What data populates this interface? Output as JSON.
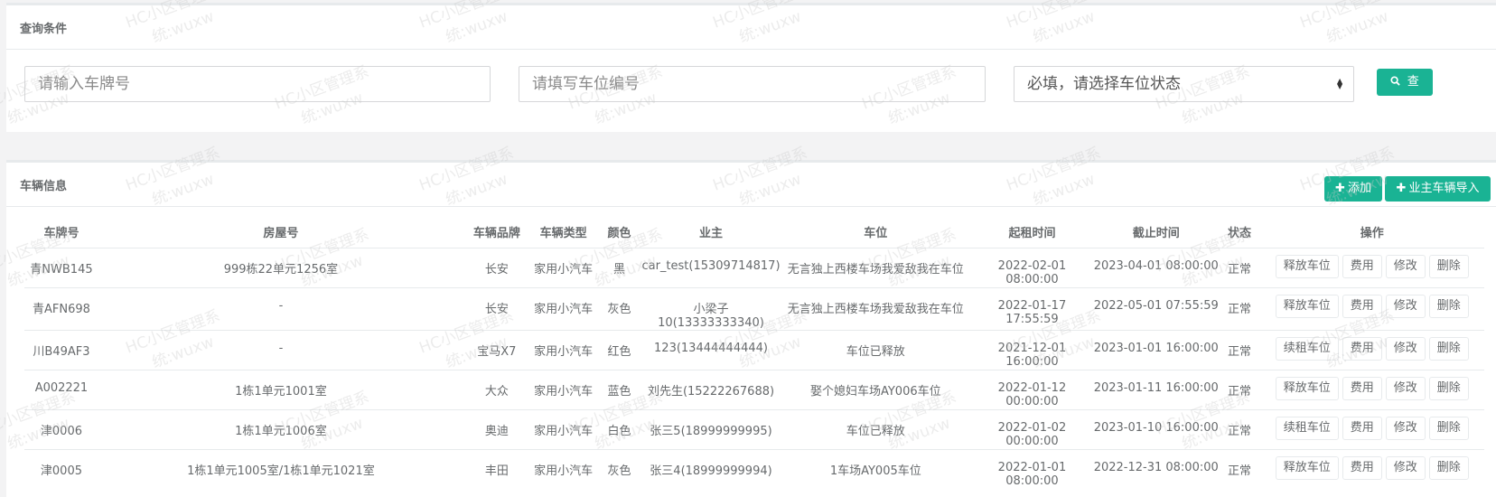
{
  "query": {
    "title": "查询条件",
    "plate_placeholder": "请输入车牌号",
    "space_placeholder": "请填写车位编号",
    "status_value": "必填，请选择车位状态",
    "search_label": "查询"
  },
  "vehicles": {
    "title": "车辆信息",
    "add_label": "添加",
    "import_label": "业主车辆导入",
    "columns": [
      "车牌号",
      "房屋号",
      "车辆品牌",
      "车辆类型",
      "颜色",
      "业主",
      "车位",
      "起租时间",
      "截止时间",
      "状态",
      "操作"
    ],
    "rows": [
      [
        "青NWB145",
        "999栋22单元1256室",
        "长安",
        "家用小汽车",
        "黑",
        "car_test(15309714817)",
        "无言独上西楼车场我爱敌我在车位",
        "2022-02-01 08:00:00",
        "2023-04-01 08:00:00",
        "正常",
        "释放车位",
        "费用",
        "修改",
        "删除"
      ],
      [
        "青AFN698",
        "-",
        "长安",
        "家用小汽车",
        "灰色",
        "小梁子10(13333333340)",
        "无言独上西楼车场我爱敌我在车位",
        "2022-01-17 17:55:59",
        "2022-05-01 07:55:59",
        "正常",
        "释放车位",
        "费用",
        "修改",
        "删除"
      ],
      [
        "川B49AF3",
        "-",
        "宝马X7",
        "家用小汽车",
        "红色",
        "123(13444444444)",
        "车位已释放",
        "2021-12-01 16:00:00",
        "2023-01-01 16:00:00",
        "正常",
        "续租车位",
        "费用",
        "修改",
        "删除"
      ],
      [
        "A002221",
        "1栋1单元1001室",
        "大众",
        "家用小汽车",
        "蓝色",
        "刘先生(15222267688)",
        "娶个媳妇车场AY006车位",
        "2022-01-12 00:00:00",
        "2023-01-11 16:00:00",
        "正常",
        "释放车位",
        "费用",
        "修改",
        "删除"
      ],
      [
        "津0006",
        "1栋1单元1006室",
        "奥迪",
        "家用小汽车",
        "白色",
        "张三5(18999999995)",
        "车位已释放",
        "2022-01-02 00:00:00",
        "2023-01-10 16:00:00",
        "正常",
        "续租车位",
        "费用",
        "修改",
        "删除"
      ],
      [
        "津0005",
        "1栋1单元1005室/1栋1单元1021室",
        "丰田",
        "家用小汽车",
        "灰色",
        "张三4(18999999994)",
        "1车场AY005车位",
        "2022-01-01 08:00:00",
        "2022-12-31 08:00:00",
        "正常",
        "释放车位",
        "费用",
        "修改",
        "删除"
      ]
    ]
  },
  "watermark": {
    "line1": "HC小区管理系",
    "line2": "统:wuxw"
  },
  "colors": {
    "accent": "#1ab394",
    "background": "#f3f3f4"
  },
  "icons": {
    "search": "search-icon",
    "add": "plus-icon"
  }
}
